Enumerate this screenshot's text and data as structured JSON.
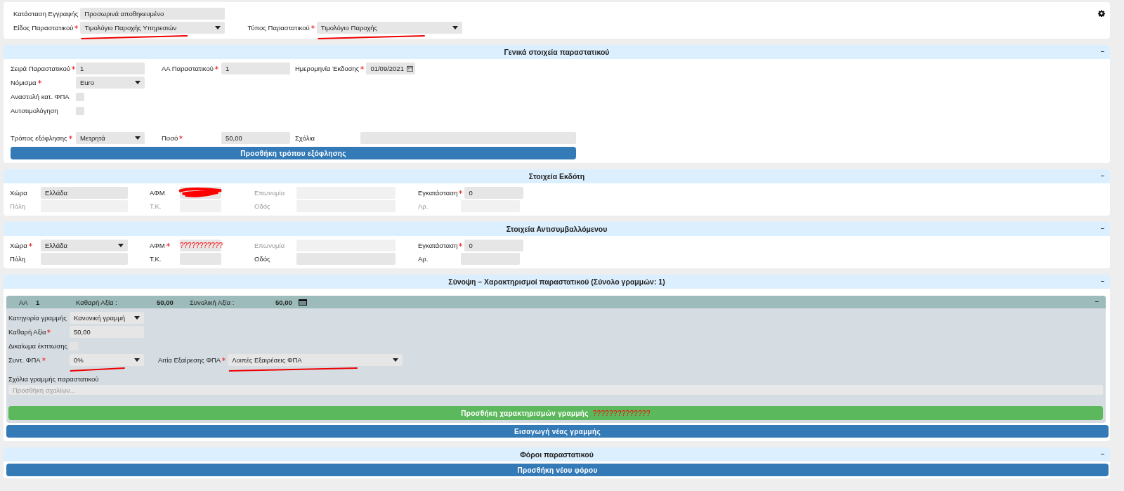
{
  "top": {
    "rows": [
      [
        {
          "label": "Κατάσταση Εγγραφής",
          "required": false,
          "disabled": false,
          "kind": "text",
          "value": "Προσωρινά αποθηκευμένο",
          "underlined": false
        }
      ],
      [
        {
          "label": "Είδος Παραστατικού",
          "required": true,
          "disabled": false,
          "kind": "select",
          "value": "Τιμολόγιο Παροχής Υπηρεσιών",
          "underlined": true
        },
        {
          "label": "Τύπος Παραστατικού",
          "required": true,
          "disabled": false,
          "kind": "select",
          "value": "Τιμολόγιο Παροχής",
          "underlined": true
        }
      ]
    ]
  },
  "general": {
    "title": "Γενικά στοιχεία παραστατικού",
    "toggle": "–",
    "rows": [
      [
        {
          "label": "Σειρά Παραστατικού",
          "required": true,
          "disabled": false,
          "kind": "text",
          "value": "1"
        },
        {
          "label": "ΑΑ Παραστατικού",
          "required": true,
          "disabled": false,
          "kind": "text",
          "value": "1"
        },
        {
          "label": "Ημερομηνία Έκδοσης",
          "required": true,
          "disabled": false,
          "kind": "date",
          "value": "01/09/2021"
        }
      ],
      [
        {
          "label": "Νόμισμα",
          "required": true,
          "disabled": false,
          "kind": "select",
          "value": "Euro"
        }
      ],
      [
        {
          "label": "Αναστολή κατ. ΦΠΑ",
          "required": false,
          "disabled": false,
          "kind": "checkbox",
          "checked": false
        }
      ],
      [
        {
          "label": "Αυτοτιμολόγηση",
          "required": false,
          "disabled": false,
          "kind": "checkbox",
          "checked": false
        }
      ],
      [
        {
          "label": "Τρόπος εξόφλησης",
          "required": true,
          "disabled": false,
          "kind": "select",
          "value": "Μετρητά"
        },
        {
          "label": "Ποσό",
          "required": true,
          "disabled": false,
          "kind": "text",
          "value": "50,00"
        },
        {
          "label": "Σχόλια",
          "required": false,
          "disabled": false,
          "kind": "text"
        }
      ]
    ],
    "button": "Προσθήκη τρόπου εξόφλησης"
  },
  "issuer": {
    "title": "Στοιχεία Εκδότη",
    "toggle": "–",
    "rows": [
      [
        {
          "label": "Χώρα",
          "required": false,
          "disabled": false,
          "kind": "text",
          "value": "Ελλάδα"
        },
        {
          "label": "ΑΦΜ",
          "required": false,
          "disabled": false,
          "kind": "text",
          "redacted": true
        },
        {
          "label": "Επωνυμία",
          "required": false,
          "disabled": true,
          "kind": "text"
        },
        {
          "label": "Εγκατάσταση",
          "required": true,
          "disabled": false,
          "kind": "text",
          "value": "0"
        }
      ],
      [
        {
          "label": "Πόλη",
          "required": false,
          "disabled": true,
          "kind": "text"
        },
        {
          "label": "Τ.Κ.",
          "required": false,
          "disabled": true,
          "kind": "text"
        },
        {
          "label": "Οδός",
          "required": false,
          "disabled": true,
          "kind": "text"
        },
        {
          "label": "Αρ.",
          "required": false,
          "disabled": true,
          "kind": "text"
        }
      ]
    ]
  },
  "counterparty": {
    "title": "Στοιχεία Αντισυμβαλλόμενου",
    "toggle": "–",
    "rows": [
      [
        {
          "label": "Χώρα",
          "required": true,
          "disabled": false,
          "kind": "select",
          "value": "Ελλάδα"
        },
        {
          "label": "ΑΦΜ",
          "required": true,
          "disabled": false,
          "kind": "text",
          "value": "???????????",
          "invalid": true
        },
        {
          "label": "Επωνυμία",
          "required": false,
          "disabled": true,
          "kind": "text"
        },
        {
          "label": "Εγκατάσταση",
          "required": true,
          "disabled": false,
          "kind": "text",
          "value": "0"
        }
      ],
      [
        {
          "label": "Πόλη",
          "required": false,
          "disabled": false,
          "kind": "text"
        },
        {
          "label": "Τ.Κ.",
          "required": false,
          "disabled": false,
          "kind": "text"
        },
        {
          "label": "Οδός",
          "required": false,
          "disabled": false,
          "kind": "text"
        },
        {
          "label": "Αρ.",
          "required": false,
          "disabled": false,
          "kind": "text"
        }
      ]
    ]
  },
  "summary": {
    "title": "Σύνοψη – Χαρακτηρισμοί παραστατικού (Σύνολο γραμμών: 1)",
    "toggle": "–",
    "line": {
      "header": [
        {
          "text": "ΑΑ",
          "bold": false
        },
        {
          "text": "1",
          "bold": true
        },
        {
          "text": "Καθαρή Αξία :",
          "bold": false
        },
        {
          "text": "50,00",
          "bold": true
        },
        {
          "text": "Συνολική Αξία :",
          "bold": false
        },
        {
          "text": "50,00",
          "bold": true
        }
      ],
      "toggle": "–",
      "rows": [
        [
          {
            "label": "Κατηγορία γραμμής",
            "required": false,
            "disabled": false,
            "kind": "select",
            "value": "Κανονική γραμμή"
          }
        ],
        [
          {
            "label": "Καθαρή Αξία",
            "required": true,
            "disabled": false,
            "kind": "text",
            "value": "50,00"
          }
        ],
        [
          {
            "label": "Δικαίωμα έκπτωσης",
            "required": false,
            "disabled": false,
            "kind": "checkbox",
            "checked": false
          }
        ],
        [
          {
            "label": "Συντ. ΦΠΑ",
            "required": true,
            "disabled": false,
            "kind": "select",
            "value": "0%",
            "underlined": true
          },
          {
            "label": "Αιτία Εξαίρεσης ΦΠΑ",
            "required": true,
            "disabled": false,
            "kind": "select",
            "value": "Λοιπές Εξαιρέσεις ΦΠΑ",
            "underlined": true
          }
        ]
      ],
      "comments": {
        "label": "Σχόλια γραμμής παραστατικού",
        "placeholder": "Προσθήκη σχολίων..."
      },
      "button": {
        "label": "Προσθήκη χαρακτηρισμών γραμμής",
        "note": "??????????????"
      }
    },
    "button": "Εισαγωγή νέας γραμμής"
  },
  "taxes": {
    "title": "Φόροι παραστατικού",
    "toggle": "–",
    "button": "Προσθήκη νέου φόρου"
  }
}
